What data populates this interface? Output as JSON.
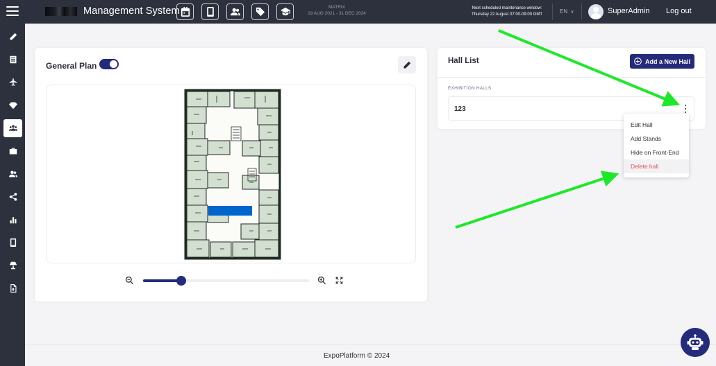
{
  "header": {
    "app_title": "Management System",
    "event_name": "MATRIX",
    "event_dates": "19 AUG 2021 - 31 DEC 2024",
    "maintenance_title": "Next scheduled maintenance window:",
    "maintenance_time": "Thursday 22 August 07:00-09:00 GMT",
    "language": "EN",
    "username": "SuperAdmin",
    "logout_label": "Log out",
    "toolbar_icons": [
      "calendar-icon",
      "mobile-icon",
      "people-icon",
      "tag-icon",
      "graduation-cap-icon"
    ]
  },
  "sidebar": {
    "items": [
      {
        "icon": "pencil-icon",
        "active": false
      },
      {
        "icon": "list-icon",
        "active": false
      },
      {
        "icon": "plane-icon",
        "active": false
      },
      {
        "icon": "gem-icon",
        "active": false
      },
      {
        "icon": "users-icon",
        "active": true
      },
      {
        "icon": "briefcase-icon",
        "active": false
      },
      {
        "icon": "people-icon",
        "active": false
      },
      {
        "icon": "share-icon",
        "active": false
      },
      {
        "icon": "bar-chart-icon",
        "active": false
      },
      {
        "icon": "mobile-icon",
        "active": false
      },
      {
        "icon": "lamp-icon",
        "active": false
      },
      {
        "icon": "file-export-icon",
        "active": false
      }
    ]
  },
  "plan": {
    "title": "General Plan",
    "toggle_on": true,
    "zoom_level": 0.23
  },
  "halls": {
    "title": "Hall List",
    "add_button_label": "Add a New Hall",
    "section_label": "EXHIBITION HALLS",
    "items": [
      {
        "name": "123"
      }
    ]
  },
  "menu": {
    "items": [
      {
        "label": "Edit Hall",
        "danger": false
      },
      {
        "label": "Add Stands",
        "danger": false
      },
      {
        "label": "Hide on Front-End",
        "danger": false
      },
      {
        "label": "Delete hall",
        "danger": true
      }
    ]
  },
  "footer": {
    "text": "ExpoPlatform © 2024"
  },
  "colors": {
    "primary": "#232b7a",
    "topbar": "#2d303d",
    "danger": "#e0505b",
    "annotation": "#1ee82a"
  }
}
